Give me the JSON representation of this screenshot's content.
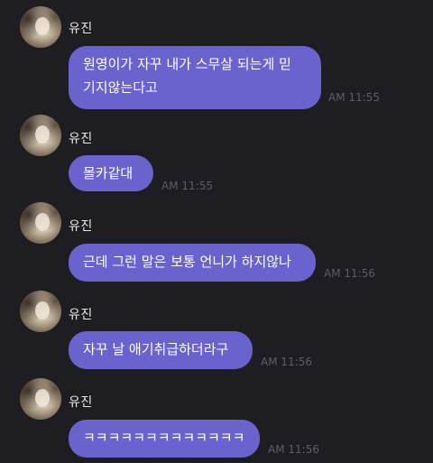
{
  "messages": [
    {
      "sender": "유진",
      "lines": [
        "원영이가 자꾸 내가 스무살 되는게 믿",
        "기지않는다고"
      ],
      "time": "AM 11:55"
    },
    {
      "sender": "유진",
      "lines": [
        "몰카같대"
      ],
      "time": "AM 11:55"
    },
    {
      "sender": "유진",
      "lines": [
        "근데 그런 말은 보통 언니가 하지않나"
      ],
      "time": "AM 11:56"
    },
    {
      "sender": "유진",
      "lines": [
        "자꾸 날 애기취급하더라구"
      ],
      "time": "AM 11:56"
    },
    {
      "sender": "유진",
      "lines": [
        "ㅋㅋㅋㅋㅋㅋㅋㅋㅋㅋㅋㅋㅋ"
      ],
      "time": "AM 11:56"
    }
  ],
  "colors": {
    "background": "#1e1d22",
    "bubble": "#6b63cd",
    "timestamp": "#5e5d66"
  }
}
